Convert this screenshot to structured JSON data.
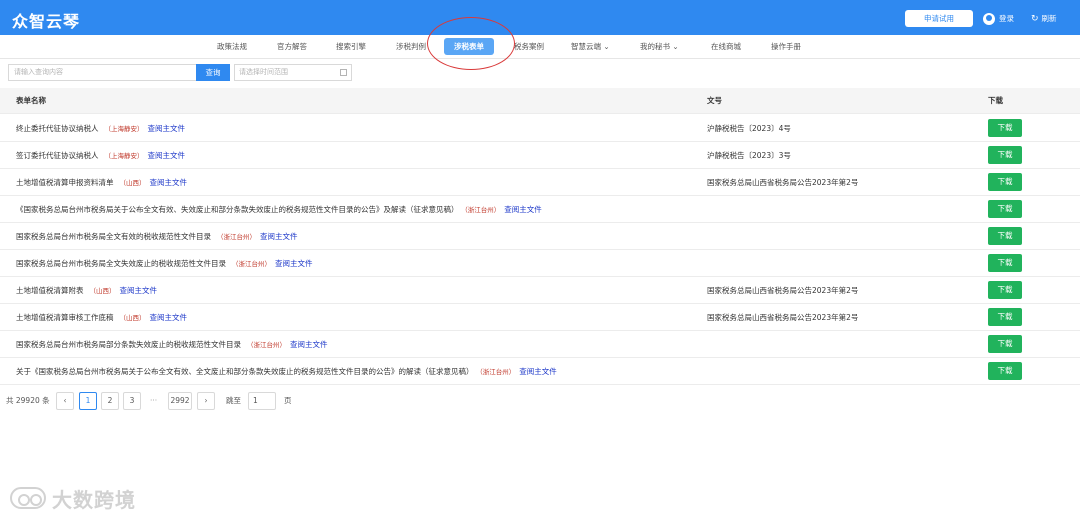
{
  "header": {
    "logo": "众智云琴",
    "trial_label": "申请试用",
    "login_label": "登录",
    "refresh_icon": "↻",
    "refresh_label": "刷新"
  },
  "nav": {
    "items": [
      "政策法规",
      "官方解答",
      "搜索引擎",
      "涉税判例",
      "涉税表单",
      "税务案例",
      "智慧云端 ⌄",
      "我的秘书 ⌄",
      "在线商城",
      "操作手册"
    ],
    "active_index": 4
  },
  "search": {
    "placeholder": "请输入查询内容",
    "button_label": "查询",
    "date_placeholder": "请选择时间范围"
  },
  "table": {
    "headers": [
      "表单名称",
      "文号",
      "下载"
    ],
    "link_label": "查阅主文件",
    "download_label": "下载",
    "rows": [
      {
        "name": "终止委托代征协议纳税人",
        "region": "（上海静安）",
        "doc": "沪静税税告〔2023〕4号"
      },
      {
        "name": "签订委托代征协议纳税人",
        "region": "（上海静安）",
        "doc": "沪静税税告〔2023〕3号"
      },
      {
        "name": "土地增值税清算申报资料清单",
        "region": "（山西）",
        "doc": "国家税务总局山西省税务局公告2023年第2号"
      },
      {
        "name": "《国家税务总局台州市税务局关于公布全文有效、失效废止和部分条款失效废止的税务规范性文件目录的公告》及解读（征求意见稿）",
        "region": "（浙江台州）",
        "doc": ""
      },
      {
        "name": "国家税务总局台州市税务局全文有效的税收规范性文件目录",
        "region": "（浙江台州）",
        "doc": ""
      },
      {
        "name": "国家税务总局台州市税务局全文失效废止的税收规范性文件目录",
        "region": "（浙江台州）",
        "doc": ""
      },
      {
        "name": "土地增值税清算附表",
        "region": "（山西）",
        "doc": "国家税务总局山西省税务局公告2023年第2号"
      },
      {
        "name": "土地增值税清算审核工作底稿",
        "region": "（山西）",
        "doc": "国家税务总局山西省税务局公告2023年第2号"
      },
      {
        "name": "国家税务总局台州市税务局部分条款失效废止的税收规范性文件目录",
        "region": "（浙江台州）",
        "doc": ""
      },
      {
        "name": "关于《国家税务总局台州市税务局关于公布全文有效、全文废止和部分条款失效废止的税务规范性文件目录的公告》的解读（征求意见稿）",
        "region": "（浙江台州）",
        "doc": ""
      }
    ]
  },
  "pagination": {
    "total": "共 29920 条",
    "prev": "‹",
    "pages": [
      "1",
      "2",
      "3"
    ],
    "dots": "···",
    "last": "2992",
    "next": "›",
    "goto_label": "跳至",
    "goto_value": "1",
    "page_suffix": "页"
  },
  "watermark": {
    "text": "大数跨境"
  },
  "colors": {
    "brand": "#2f89f0",
    "download": "#21b35c",
    "region": "#c0392b",
    "link": "#1a35c8",
    "annotation": "#d93a3a"
  }
}
